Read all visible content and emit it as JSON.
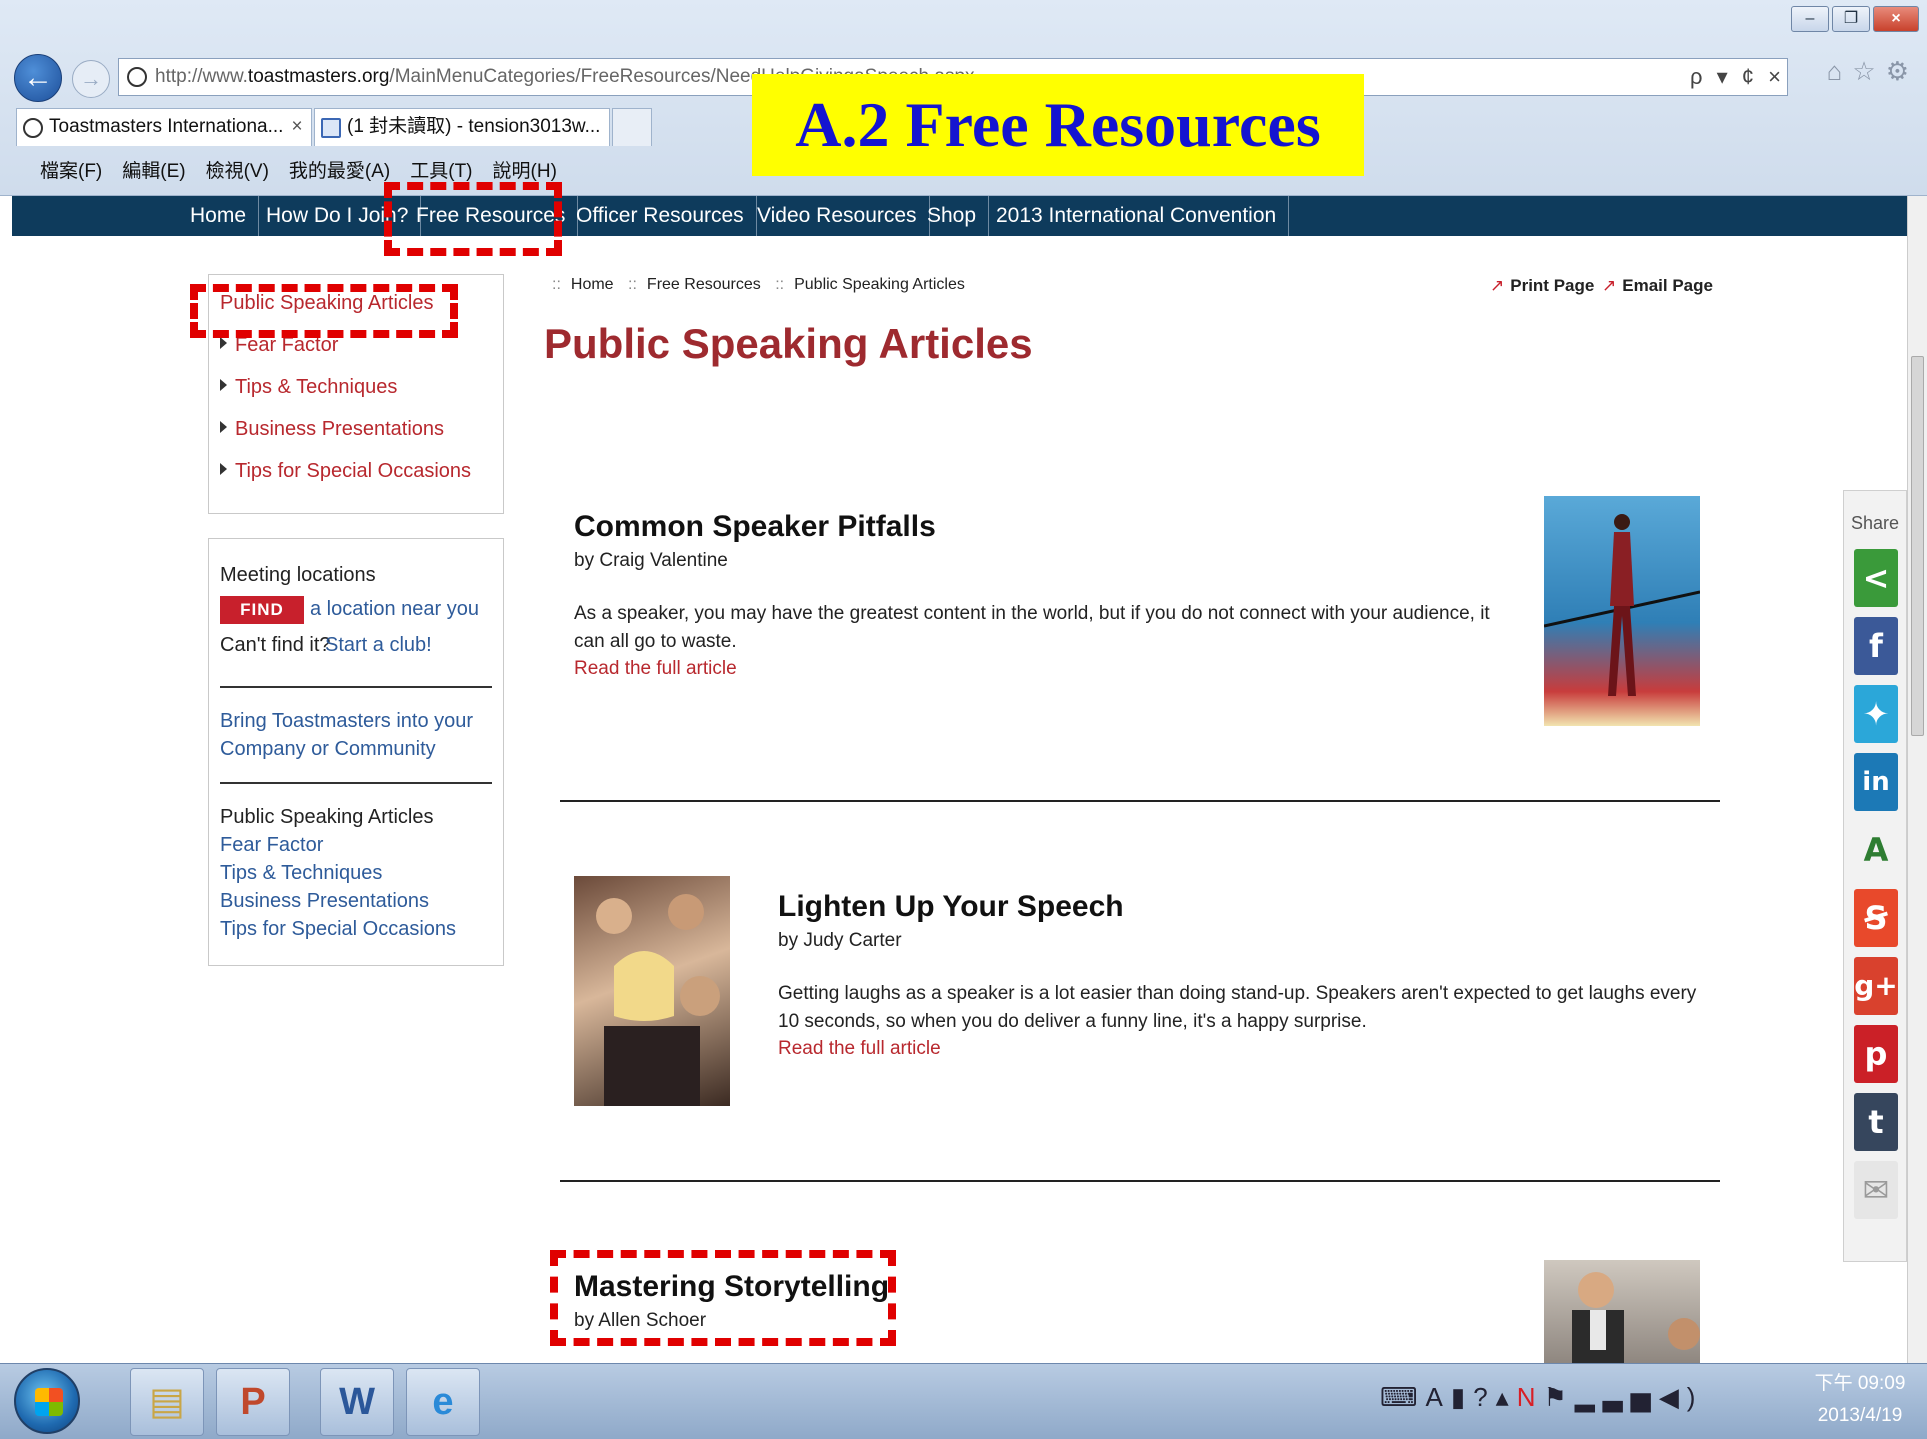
{
  "browser": {
    "url_prefix": "http://www.",
    "url_host": "toastmasters.org",
    "url_path": "/MainMenuCategories/FreeResources/NeedHelpGivingaSpeech.aspx",
    "tabs": [
      {
        "title": "Toastmasters Internationa...",
        "close": "×"
      },
      {
        "title": "(1 封未讀取) - tension3013w..."
      }
    ],
    "menu": [
      "檔案(F)",
      "編輯(E)",
      "檢視(V)",
      "我的最愛(A)",
      "工具(T)",
      "說明(H)"
    ],
    "addr_tools": "ρ ▾ ¢ ×"
  },
  "banner": {
    "text": "A.2 Free Resources"
  },
  "site_nav": [
    "Home",
    "How Do I Join?",
    "Free Resources",
    "Officer Resources",
    "Video Resources",
    "Shop",
    "2013 International Convention"
  ],
  "sidebar": {
    "heading": "Public Speaking Articles",
    "items": [
      "Fear Factor",
      "Tips & Techniques",
      "Business Presentations",
      "Tips for Special Occasions"
    ],
    "meeting_label": "Meeting locations",
    "find_button": "FIND",
    "find_text": "a location near you",
    "cant_find": "Can't find it?",
    "start_club": "Start a club!",
    "bring_line1": "Bring Toastmasters into your",
    "bring_line2": "Company or Community",
    "bottom_heading": "Public Speaking Articles",
    "bottom_items": [
      "Fear Factor",
      "Tips & Techniques",
      "Business Presentations",
      "Tips for Special Occasions"
    ]
  },
  "breadcrumb": [
    "Home",
    "Free Resources",
    "Public Speaking Articles"
  ],
  "breadcrumb_sep": "::",
  "utilities": {
    "print": "Print Page",
    "email": "Email Page"
  },
  "page_title": "Public Speaking Articles",
  "articles": [
    {
      "title": "Common Speaker Pitfalls",
      "author": "by Craig Valentine",
      "body": "As a speaker, you may have the greatest content in the world, but if you do not connect with your audience, it can all go to waste.",
      "link": "Read the full article"
    },
    {
      "title": "Lighten Up Your Speech",
      "author": "by Judy Carter",
      "body": "Getting laughs as a speaker is a lot easier than doing stand-up. Speakers aren't expected to get laughs every 10 seconds, so when you do deliver a funny line, it's a happy surprise.",
      "link": "Read the full article"
    },
    {
      "title": "Mastering Storytelling",
      "author": "by Allen Schoer"
    }
  ],
  "share": {
    "label": "Share"
  },
  "taskbar": {
    "time": "下午 09:09",
    "date": "2013/4/19"
  },
  "colors": {
    "nav": "#0e3b5c",
    "title": "#9e2a2f",
    "link": "#b8282e",
    "banner_bg": "#ffff00",
    "banner_fg": "#1414d0",
    "highlight": "#e00000"
  }
}
